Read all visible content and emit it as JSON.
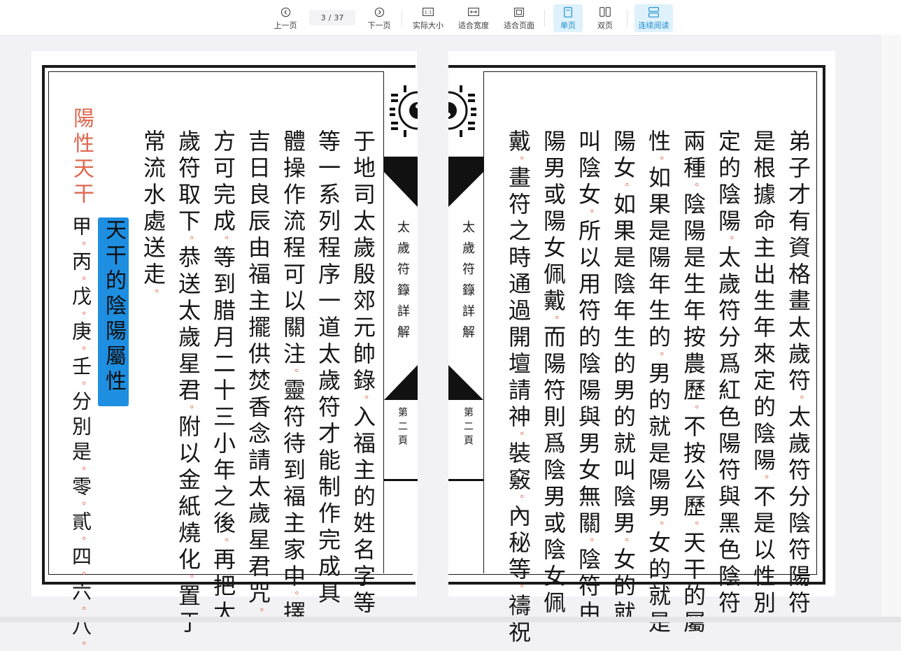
{
  "toolbar": {
    "prev": "上一页",
    "current_page": "3",
    "page_sep": "/",
    "total_pages": "37",
    "next": "下一页",
    "actual_size": "实际大小",
    "fit_width": "适合宽度",
    "fit_page": "适合页面",
    "single_page": "单页",
    "double_page": "双页",
    "continuous": "连续阅读",
    "accent": "#1a8fd0",
    "active_bg": "#dff1fb"
  },
  "left_page": {
    "spine_title": "太歲符籙詳解",
    "spine_page": "第二頁",
    "columns": [
      {
        "text": "于地司太歲殷郊元帥錄",
        "p1": "。",
        "rest": "入福主的姓名字等"
      },
      {
        "text": "等一系列程序一道太歲符才能制作完成具",
        "p1": "",
        "rest": ""
      },
      {
        "text": "體操作流程可以關注",
        "p1": "。",
        "rest": "靈符待到福主家中",
        "p2": "。",
        "rest2": "擇"
      },
      {
        "text": "吉日良辰由福主擺供焚香念請太歲星君咒",
        "p1": "。",
        "rest": ""
      },
      {
        "text": "方可完成",
        "p1": "。",
        "rest": "等到腊月二十三小年之後",
        "p2": "。",
        "rest2": "再把太"
      },
      {
        "text": "歲符取下",
        "p1": "。",
        "rest": "恭送太歲星君",
        "p2": "。",
        "rest2": "附以金紙燒化",
        "p3": "。",
        "rest3": "置于"
      },
      {
        "text": "常流水處送走",
        "p1": "。",
        "rest": ""
      }
    ],
    "heading": "天干的陰陽屬性",
    "red_label": "陽性天干",
    "stems": [
      {
        "char": "甲",
        "p": "。"
      },
      {
        "char": "丙",
        "p": "。"
      },
      {
        "char": "戊",
        "p": "。"
      },
      {
        "char": "庚",
        "p": "。"
      },
      {
        "char": "壬",
        "p": "。"
      },
      {
        "char": "分別是",
        "p": "。"
      },
      {
        "char": "零",
        "p": "。"
      },
      {
        "char": "貳",
        "p": "。"
      },
      {
        "char": "四",
        "p": "。"
      },
      {
        "char": "六",
        "p": "。"
      },
      {
        "char": "八",
        "p": "。"
      }
    ]
  },
  "right_page": {
    "spine_title": "太歲符籙詳解",
    "spine_page": "第二頁",
    "columns": [
      {
        "text": "弟子才有資格畫太歲符",
        "p1": "。",
        "rest": "太歲符分陰符陽符",
        "p2": "。"
      },
      {
        "text": "是根據命主出生年來定的陰陽",
        "p1": "。",
        "rest": "不是以性別"
      },
      {
        "text": "定的陰陽",
        "p1": "。",
        "rest": "太歲符分爲紅色陽符與黑色陰符"
      },
      {
        "text": "兩種",
        "p1": "。",
        "rest": "陰陽是生年按農歷",
        "p2": "。",
        "rest2": "不按公歷",
        "p3": "。",
        "rest3": "天干的屬"
      },
      {
        "text": "性",
        "p1": "。",
        "rest": "如果是陽年生的",
        "p2": "。",
        "rest2": "男的就是陽男",
        "p3": "。",
        "rest3": "女的就是"
      },
      {
        "text": "陽女",
        "p1": "。",
        "rest": "如果是陰年生的男的就叫陰男",
        "p2": "。",
        "rest2": "女的就"
      },
      {
        "text": "叫陰女",
        "p1": "。",
        "rest": "所以用符的陰陽與男女無關",
        "p2": "。",
        "rest2": "陰符由"
      },
      {
        "text": "陽男或陽女佩戴",
        "p1": "。",
        "rest": "而陽符則爲陰男或陰女佩"
      },
      {
        "text": "戴",
        "p1": "。",
        "rest": "畫符之時通過開壇請神",
        "p2": "。",
        "rest2": "裝竅",
        "p3": "。",
        "rest3": "內秘等",
        "p4": "。",
        "rest4": "禱祝"
      }
    ]
  }
}
